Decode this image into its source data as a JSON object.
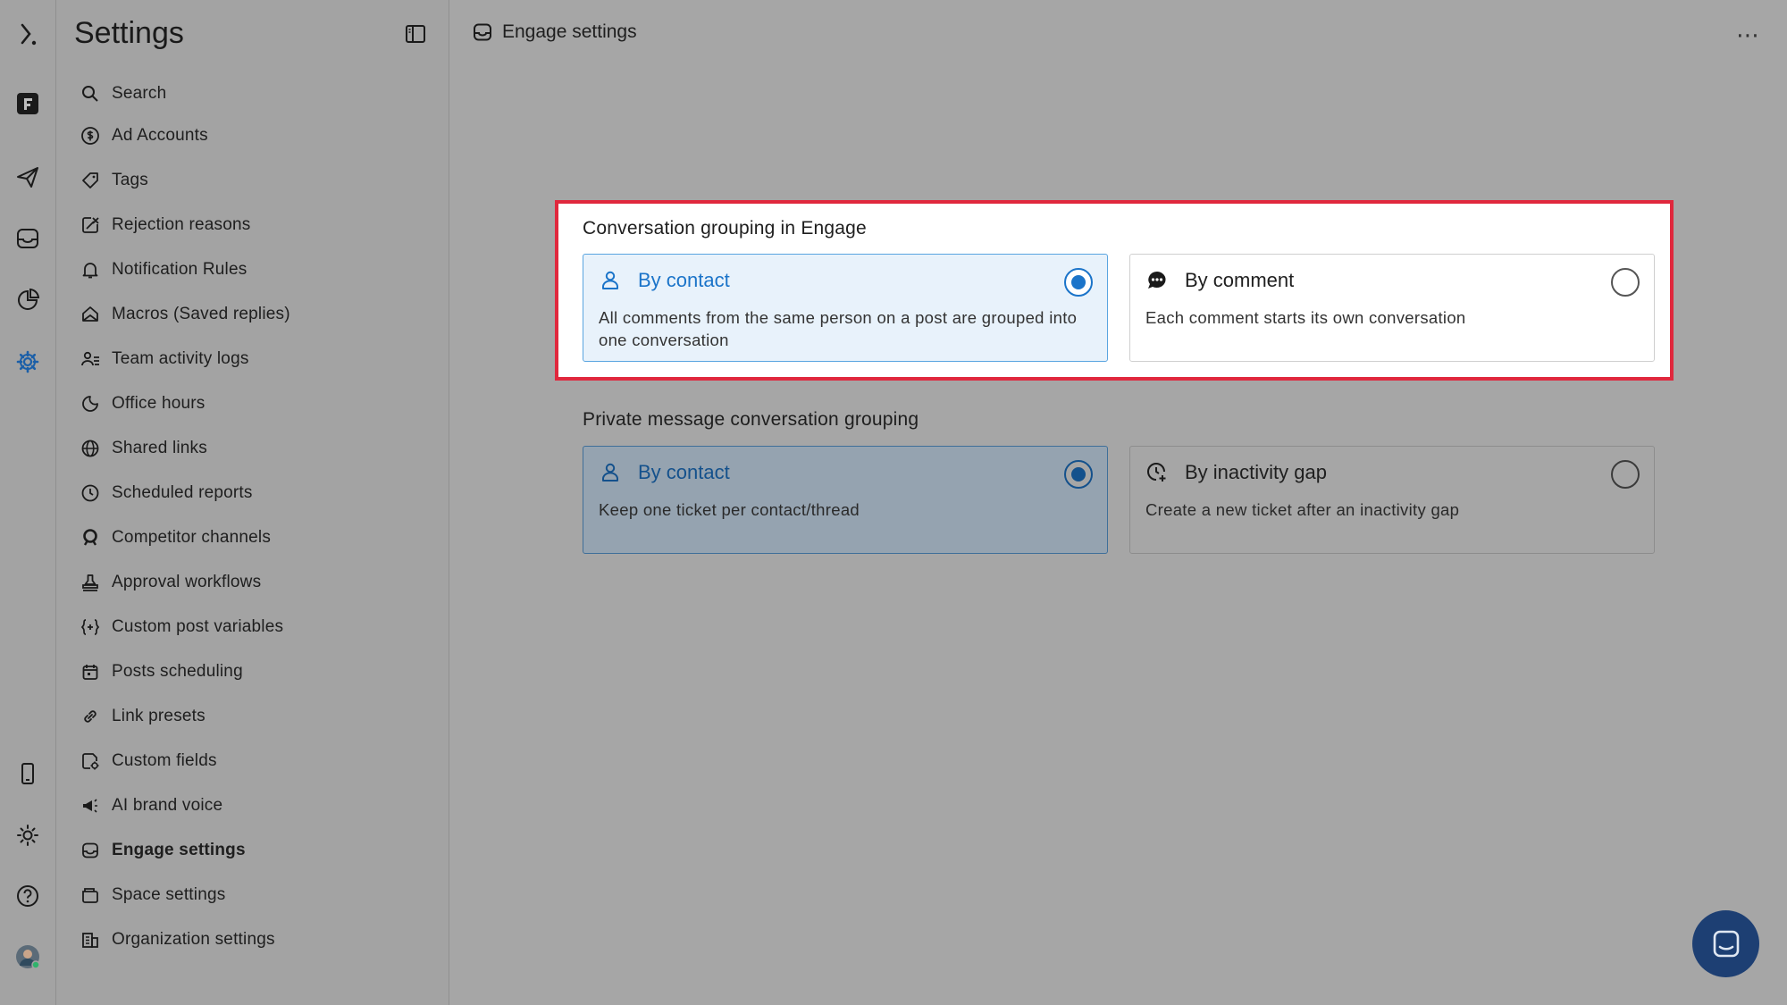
{
  "sidebar": {
    "title": "Settings",
    "items": [
      {
        "label": "Search",
        "icon": "search-icon"
      },
      {
        "label": "Ad Accounts",
        "icon": "dollar-icon"
      },
      {
        "label": "Tags",
        "icon": "tag-icon"
      },
      {
        "label": "Rejection reasons",
        "icon": "rejection-icon"
      },
      {
        "label": "Notification Rules",
        "icon": "bell-icon"
      },
      {
        "label": "Macros (Saved replies)",
        "icon": "macros-icon"
      },
      {
        "label": "Team activity logs",
        "icon": "team-icon"
      },
      {
        "label": "Office hours",
        "icon": "moon-clock-icon"
      },
      {
        "label": "Shared links",
        "icon": "globe-icon"
      },
      {
        "label": "Scheduled reports",
        "icon": "clock-icon"
      },
      {
        "label": "Competitor channels",
        "icon": "competitor-icon"
      },
      {
        "label": "Approval workflows",
        "icon": "stamp-icon"
      },
      {
        "label": "Custom post variables",
        "icon": "variables-icon"
      },
      {
        "label": "Posts scheduling",
        "icon": "calendar-icon"
      },
      {
        "label": "Link presets",
        "icon": "link-icon"
      },
      {
        "label": "Custom fields",
        "icon": "custom-fields-icon"
      },
      {
        "label": "AI brand voice",
        "icon": "megaphone-icon"
      },
      {
        "label": "Engage settings",
        "icon": "inbox-icon",
        "active": true
      },
      {
        "label": "Space settings",
        "icon": "space-icon"
      },
      {
        "label": "Organization settings",
        "icon": "organization-icon"
      }
    ]
  },
  "header": {
    "title": "Engage settings"
  },
  "engage_grouping": {
    "title": "Conversation grouping in Engage",
    "options": [
      {
        "label": "By contact",
        "description": "All comments from the same person on a post are grouped into one conversation",
        "selected": true,
        "icon": "person-icon"
      },
      {
        "label": "By comment",
        "description": "Each comment starts its own conversation",
        "selected": false,
        "icon": "comment-icon"
      }
    ]
  },
  "private_grouping": {
    "title": "Private message conversation grouping",
    "options": [
      {
        "label": "By contact",
        "description": "Keep one ticket per contact/thread",
        "selected": true,
        "icon": "person-icon"
      },
      {
        "label": "By inactivity gap",
        "description": "Create a new ticket after an inactivity gap",
        "selected": false,
        "icon": "clock-plus-icon"
      }
    ]
  },
  "colors": {
    "accent": "#1b74c9",
    "highlight_border": "#e0283d",
    "chat_button": "#1d3f73"
  }
}
